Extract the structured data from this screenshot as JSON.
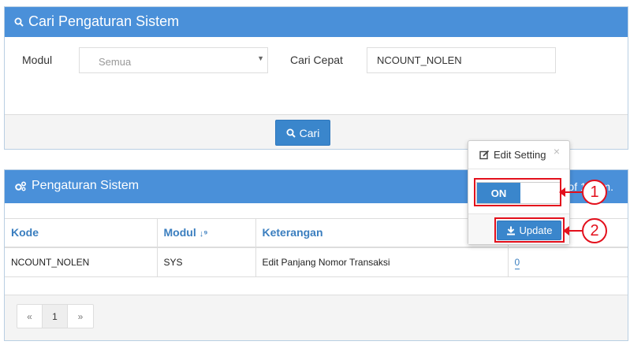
{
  "search_panel": {
    "title": "Cari Pengaturan Sistem",
    "modul_label": "Modul",
    "modul_value": "Semua",
    "cari_cepat_label": "Cari Cepat",
    "cari_cepat_value": "NCOUNT_NOLEN",
    "search_button": "Cari"
  },
  "list_panel": {
    "title": "Pengaturan Sistem",
    "header_right": "of 1 item.",
    "columns": [
      "Kode",
      "Modul",
      "Keterangan"
    ],
    "rows": [
      {
        "kode": "NCOUNT_NOLEN",
        "modul": "SYS",
        "keterangan": "Edit Panjang Nomor Transaksi",
        "value": "0"
      }
    ],
    "pager": [
      "«",
      "1",
      "»"
    ]
  },
  "popover": {
    "title": "Edit Setting",
    "close": "×",
    "toggle_state": "ON",
    "update_button": "Update"
  },
  "annotations": [
    "1",
    "2"
  ],
  "colors": {
    "accent": "#4a90d9",
    "button": "#3a86cc",
    "highlight": "#e3101c"
  },
  "icons": {
    "search": "search-icon",
    "gears": "gears-icon",
    "edit": "edit-icon",
    "download": "download-icon",
    "sort": "sort-numeric-icon"
  }
}
